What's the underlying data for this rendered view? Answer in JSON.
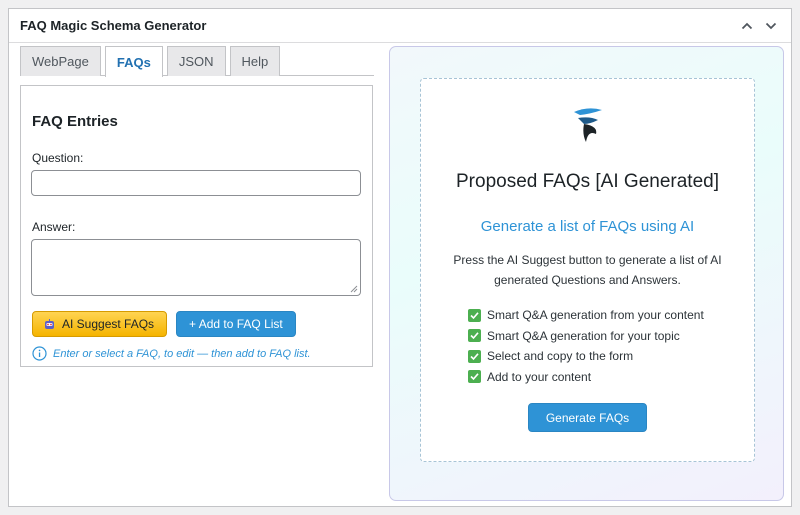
{
  "postbox": {
    "title": "FAQ Magic Schema Generator",
    "collapse_up_icon": "chevron-up-icon",
    "collapse_down_icon": "chevron-down-icon"
  },
  "tabs": [
    {
      "label": "WebPage",
      "active": false
    },
    {
      "label": "FAQs",
      "active": true
    },
    {
      "label": "JSON",
      "active": false
    },
    {
      "label": "Help",
      "active": false
    }
  ],
  "faq_form": {
    "heading": "FAQ Entries",
    "question_label": "Question:",
    "question_value": "",
    "answer_label": "Answer:",
    "answer_value": "",
    "ai_suggest_label": "AI Suggest FAQs",
    "ai_suggest_icon": "robot-icon",
    "add_label": "+ Add to FAQ List",
    "hint_icon": "info-icon",
    "hint": "Enter or select a FAQ, to edit — then add to FAQ list."
  },
  "proposed": {
    "logo_icon": "brand-logo-icon",
    "title": "Proposed FAQs [AI Generated]",
    "subtitle": "Generate a list of FAQs using AI",
    "description": "Press the AI Suggest button to generate a list of AI generated Questions and Answers.",
    "features": [
      "Smart Q&A generation from your content",
      "Smart Q&A generation for your topic",
      "Select and copy to the form",
      "Add to your content"
    ],
    "feature_icon": "checkbox-checked-icon",
    "generate_label": "Generate FAQs"
  },
  "colors": {
    "accent": "#2e93d6",
    "ai_button": "#f5b400",
    "check": "#4caf50"
  }
}
